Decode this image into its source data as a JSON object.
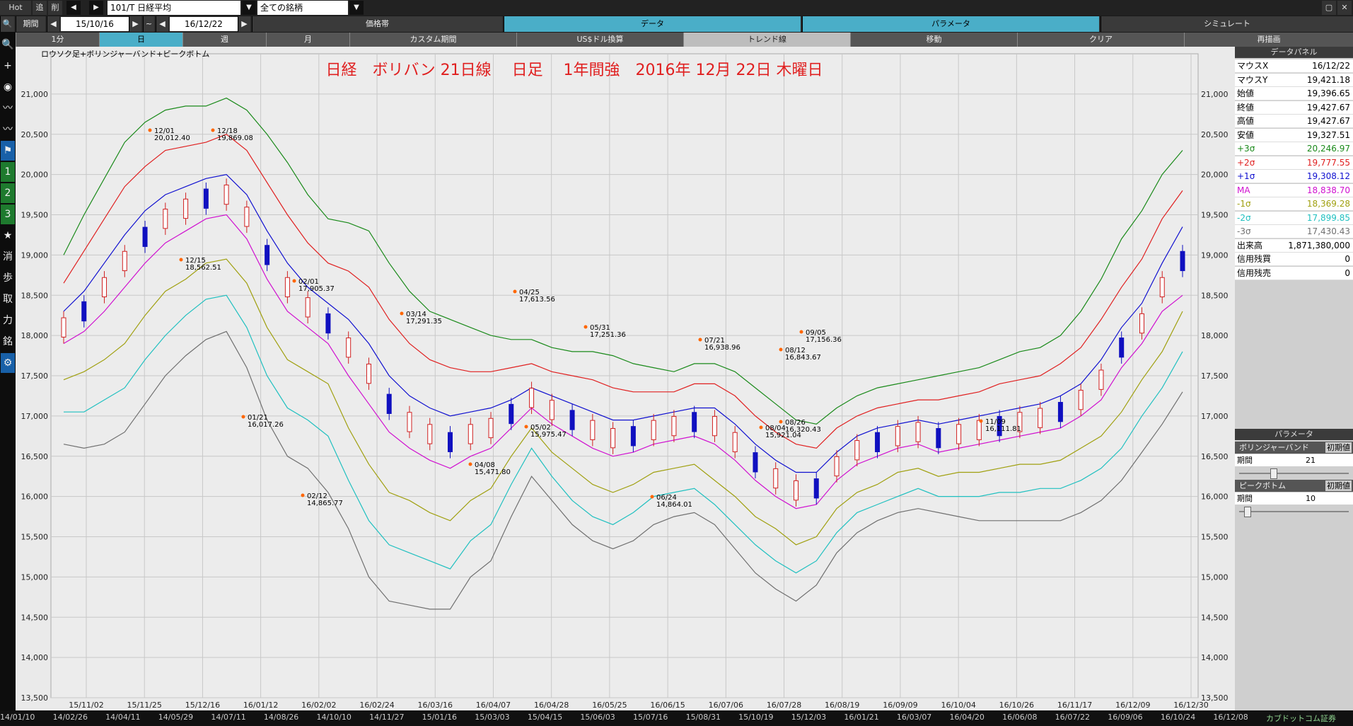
{
  "topbar": {
    "hot": "Hot",
    "add": "追",
    "del": "削",
    "symbol": "101/T 日経平均",
    "market": "全ての銘柄",
    "period_label": "期間",
    "date_from": "15/10/16",
    "tilde": "~",
    "date_to": "16/12/22"
  },
  "menu": {
    "items": [
      "価格帯",
      "データ",
      "パラメータ",
      "シミュレート"
    ]
  },
  "timeframes": {
    "items": [
      "1分",
      "日",
      "週",
      "月",
      "カスタム期間",
      "US$ドル換算",
      "トレンド線",
      "移動",
      "クリア",
      "再描画"
    ],
    "active": "日"
  },
  "left_toolbar": {
    "items": [
      {
        "icon": "search-icon",
        "glyph": "🔍"
      },
      {
        "icon": "crosshair-icon",
        "glyph": "+"
      },
      {
        "icon": "camera-icon",
        "glyph": "◉"
      },
      {
        "icon": "trend-red-icon",
        "glyph": "〰"
      },
      {
        "icon": "trend-purple-icon",
        "glyph": "〰"
      },
      {
        "icon": "flag-icon",
        "glyph": "⚑"
      },
      {
        "icon": "one-icon",
        "glyph": "1"
      },
      {
        "icon": "two-icon",
        "glyph": "2"
      },
      {
        "icon": "three-icon",
        "glyph": "3"
      },
      {
        "icon": "star-icon",
        "glyph": "★"
      },
      {
        "icon": "erase-icon",
        "glyph": "消"
      },
      {
        "icon": "tick-icon",
        "glyph": "歩"
      },
      {
        "icon": "trade-icon",
        "glyph": "取"
      },
      {
        "icon": "power-icon",
        "glyph": "力"
      },
      {
        "icon": "stock-icon",
        "glyph": "銘"
      },
      {
        "icon": "settings-icon",
        "glyph": "⚙"
      }
    ]
  },
  "chart_data": {
    "type": "line",
    "title": "日経　ボリバン 21日線　 日足　 1年間強　2016年 12月 22日 木曜日",
    "legend_label": "ロウソク足+ボリンジャーバンド+ピークボトム",
    "ylim": [
      13500,
      21500
    ],
    "yticks": [
      13500,
      14000,
      14500,
      15000,
      15500,
      16000,
      16500,
      17000,
      17500,
      18000,
      18500,
      19000,
      19500,
      20000,
      20500,
      21000
    ],
    "x_ticks": [
      "15/11/02",
      "15/11/25",
      "15/12/16",
      "16/01/12",
      "16/02/02",
      "16/02/24",
      "16/03/16",
      "16/04/07",
      "16/04/28",
      "16/05/25",
      "16/06/15",
      "16/07/06",
      "16/07/28",
      "16/08/19",
      "16/09/09",
      "16/10/04",
      "16/10/26",
      "16/11/17",
      "16/12/09",
      "16/12/30"
    ],
    "series": [
      {
        "name": "+3σ",
        "color": "#1a8a1a"
      },
      {
        "name": "+2σ",
        "color": "#e02020"
      },
      {
        "name": "+1σ",
        "color": "#1010d0"
      },
      {
        "name": "MA",
        "color": "#d010d0"
      },
      {
        "name": "-1σ",
        "color": "#a0a010"
      },
      {
        "name": "-2σ",
        "color": "#20c0c0"
      },
      {
        "name": "-3σ",
        "color": "#707070"
      }
    ],
    "ma": [
      17900,
      18050,
      18300,
      18600,
      18900,
      19150,
      19300,
      19450,
      19500,
      19200,
      18700,
      18300,
      18100,
      17900,
      17500,
      17150,
      16800,
      16600,
      16450,
      16350,
      16500,
      16600,
      16850,
      17100,
      16900,
      16750,
      16600,
      16500,
      16550,
      16650,
      16700,
      16750,
      16650,
      16450,
      16200,
      16000,
      15850,
      15900,
      16200,
      16400,
      16500,
      16600,
      16650,
      16550,
      16600,
      16650,
      16700,
      16750,
      16800,
      16850,
      17000,
      17200,
      17600,
      17900,
      18300,
      18500
    ],
    "upper1": [
      18300,
      18550,
      18900,
      19250,
      19550,
      19750,
      19850,
      19950,
      20000,
      19750,
      19300,
      18900,
      18600,
      18400,
      18200,
      17900,
      17500,
      17250,
      17100,
      17000,
      17050,
      17100,
      17200,
      17350,
      17250,
      17150,
      17050,
      16950,
      16950,
      17000,
      17050,
      17100,
      17100,
      16900,
      16650,
      16450,
      16300,
      16300,
      16550,
      16750,
      16850,
      16900,
      16950,
      16900,
      16950,
      17000,
      17050,
      17100,
      17150,
      17250,
      17400,
      17700,
      18100,
      18400,
      18900,
      19350
    ],
    "upper2": [
      18650,
      19050,
      19450,
      19850,
      20100,
      20300,
      20350,
      20400,
      20500,
      20300,
      19900,
      19500,
      19150,
      18900,
      18800,
      18600,
      18200,
      17900,
      17700,
      17600,
      17550,
      17550,
      17600,
      17650,
      17550,
      17500,
      17450,
      17350,
      17300,
      17300,
      17300,
      17400,
      17400,
      17250,
      17000,
      16800,
      16650,
      16600,
      16850,
      17000,
      17100,
      17150,
      17200,
      17200,
      17250,
      17300,
      17400,
      17450,
      17500,
      17650,
      17850,
      18200,
      18600,
      18950,
      19450,
      19800
    ],
    "upper3": [
      19000,
      19500,
      19950,
      20400,
      20650,
      20800,
      20850,
      20850,
      20950,
      20800,
      20500,
      20150,
      19750,
      19450,
      19400,
      19300,
      18900,
      18550,
      18300,
      18200,
      18100,
      18000,
      17950,
      17950,
      17850,
      17800,
      17800,
      17750,
      17650,
      17600,
      17550,
      17650,
      17650,
      17550,
      17350,
      17150,
      16950,
      16900,
      17100,
      17250,
      17350,
      17400,
      17450,
      17500,
      17550,
      17600,
      17700,
      17800,
      17850,
      18000,
      18300,
      18700,
      19200,
      19550,
      20000,
      20300
    ],
    "lower1": [
      17450,
      17550,
      17700,
      17900,
      18250,
      18550,
      18700,
      18900,
      18950,
      18650,
      18100,
      17700,
      17550,
      17400,
      16850,
      16400,
      16050,
      15950,
      15800,
      15700,
      15950,
      16100,
      16500,
      16850,
      16550,
      16350,
      16150,
      16050,
      16150,
      16300,
      16350,
      16400,
      16200,
      16000,
      15750,
      15600,
      15400,
      15500,
      15850,
      16050,
      16150,
      16300,
      16350,
      16250,
      16300,
      16300,
      16350,
      16400,
      16400,
      16450,
      16600,
      16750,
      17050,
      17450,
      17800,
      18300
    ],
    "lower2": [
      17050,
      17050,
      17200,
      17350,
      17700,
      18000,
      18250,
      18450,
      18500,
      18100,
      17500,
      17100,
      16950,
      16750,
      16200,
      15700,
      15400,
      15300,
      15200,
      15100,
      15450,
      15650,
      16150,
      16600,
      16250,
      15950,
      15750,
      15650,
      15800,
      16000,
      16050,
      16100,
      15900,
      15650,
      15400,
      15200,
      15050,
      15200,
      15550,
      15800,
      15900,
      16000,
      16100,
      16000,
      16000,
      16000,
      16050,
      16050,
      16100,
      16100,
      16200,
      16350,
      16600,
      17000,
      17350,
      17800
    ],
    "lower3": [
      16650,
      16600,
      16650,
      16800,
      17150,
      17500,
      17750,
      17950,
      18050,
      17600,
      16950,
      16500,
      16350,
      16050,
      15600,
      15000,
      14700,
      14650,
      14600,
      14600,
      15000,
      15200,
      15750,
      16250,
      15950,
      15650,
      15450,
      15350,
      15450,
      15650,
      15750,
      15800,
      15650,
      15350,
      15050,
      14850,
      14700,
      14900,
      15300,
      15550,
      15700,
      15800,
      15850,
      15800,
      15750,
      15700,
      15700,
      15700,
      15700,
      15700,
      15800,
      15950,
      16200,
      16550,
      16900,
      17300
    ]
  },
  "peaks": [
    {
      "date": "12/01",
      "value": "20,012.40"
    },
    {
      "date": "12/18",
      "value": "19,869.08"
    },
    {
      "date": "12/15",
      "value": "18,562.51"
    },
    {
      "date": "02/01",
      "value": "17,905.37"
    },
    {
      "date": "01/21",
      "value": "16,017.26"
    },
    {
      "date": "02/12",
      "value": "14,865.77"
    },
    {
      "date": "03/14",
      "value": "17,291.35"
    },
    {
      "date": "04/25",
      "value": "17,613.56"
    },
    {
      "date": "04/08",
      "value": "15,471.80"
    },
    {
      "date": "05/02",
      "value": "15,975.47"
    },
    {
      "date": "05/31",
      "value": "17,251.36"
    },
    {
      "date": "06/24",
      "value": "14,864.01"
    },
    {
      "date": "07/21",
      "value": "16,938.96"
    },
    {
      "date": "08/04",
      "value": "15,921.04"
    },
    {
      "date": "08/12",
      "value": "16,843.67"
    },
    {
      "date": "08/26",
      "value": "16,320.43"
    },
    {
      "date": "09/05",
      "value": "17,156.36"
    },
    {
      "date": "11/09",
      "value": "16,111.81"
    }
  ],
  "data_panel": {
    "title": "データパネル",
    "rows": [
      {
        "label": "マウスX",
        "value": "16/12/22",
        "color": "#000000"
      },
      {
        "label": "マウスY",
        "value": "19,421.18",
        "color": "#000000"
      },
      {
        "label": "始値",
        "value": "19,396.65",
        "color": "#000000"
      },
      {
        "label": "終値",
        "value": "19,427.67",
        "color": "#000000"
      },
      {
        "label": "高値",
        "value": "19,427.67",
        "color": "#000000"
      },
      {
        "label": "安値",
        "value": "19,327.51",
        "color": "#000000"
      },
      {
        "label": "+3σ",
        "value": "20,246.97",
        "color": "#1a8a1a"
      },
      {
        "label": "+2σ",
        "value": "19,777.55",
        "color": "#e02020"
      },
      {
        "label": "+1σ",
        "value": "19,308.12",
        "color": "#1010d0"
      },
      {
        "label": "MA",
        "value": "18,838.70",
        "color": "#d010d0"
      },
      {
        "label": "-1σ",
        "value": "18,369.28",
        "color": "#a0a010"
      },
      {
        "label": "-2σ",
        "value": "17,899.85",
        "color": "#20c0c0"
      },
      {
        "label": "-3σ",
        "value": "17,430.43",
        "color": "#707070"
      },
      {
        "label": "出来高",
        "value": "1,871,380,000",
        "color": "#000000"
      },
      {
        "label": "信用残買",
        "value": "0",
        "color": "#000000"
      },
      {
        "label": "信用残売",
        "value": "0",
        "color": "#000000"
      }
    ]
  },
  "param_panel": {
    "title": "パラメータ",
    "bollinger": {
      "name": "ボリンジャーバンド",
      "init": "初期値",
      "period_label": "期間",
      "period": "21",
      "slider_fraction": 0.3
    },
    "peakbottom": {
      "name": "ピークボトム",
      "init": "初期値",
      "period_label": "期間",
      "period": "10",
      "slider_fraction": 0.05
    }
  },
  "bottom_dates": [
    "14/01/10",
    "14/02/26",
    "14/04/11",
    "14/05/29",
    "14/07/11",
    "14/08/26",
    "14/10/10",
    "14/11/27",
    "15/01/16",
    "15/03/03",
    "15/04/15",
    "15/06/03",
    "15/07/16",
    "15/08/31",
    "15/10/19",
    "15/12/03",
    "16/01/21",
    "16/03/07",
    "16/04/20",
    "16/06/08",
    "16/07/22",
    "16/09/06",
    "16/10/24",
    "16/12/08"
  ],
  "bottom_brand": "カブドットコム証券"
}
